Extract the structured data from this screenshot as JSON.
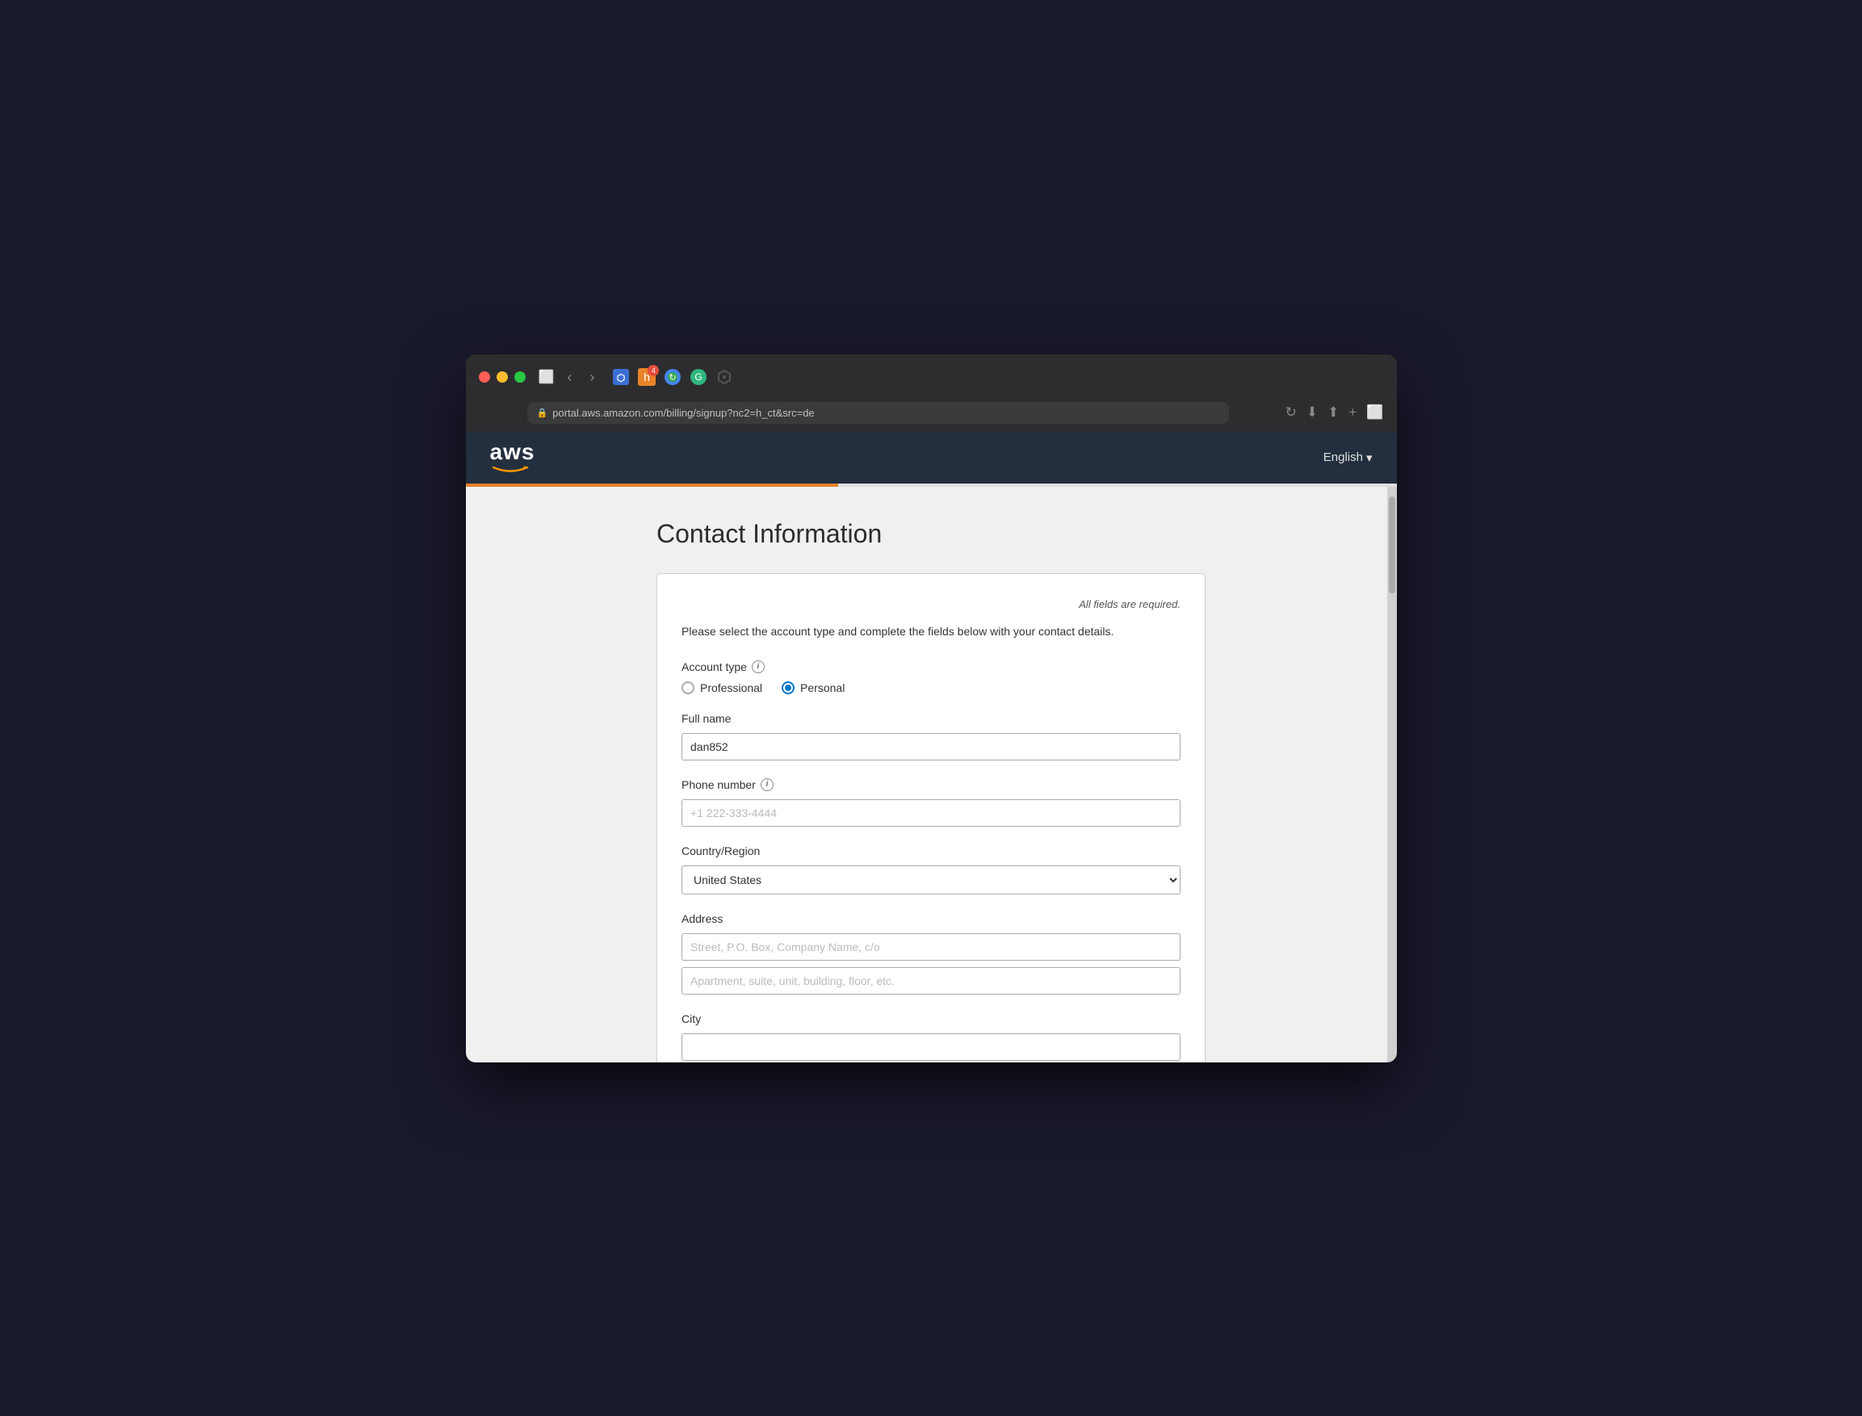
{
  "browser": {
    "url": "portal.aws.amazon.com/billing/signup?nc2=h_ct&src=de...",
    "url_display": "portal.aws.amazon.com/billing/signup?nc2=h_ct&src=de",
    "lang": "English",
    "lang_dropdown": "▾"
  },
  "header": {
    "logo_text": "aws",
    "logo_smile": "〜",
    "language_label": "English",
    "language_arrow": "▾"
  },
  "page": {
    "title": "Contact Information",
    "required_note": "All fields are required.",
    "intro": "Please select the account type and complete the fields below with your contact details."
  },
  "form": {
    "account_type_label": "Account type",
    "professional_label": "Professional",
    "personal_label": "Personal",
    "selected_account_type": "personal",
    "full_name_label": "Full name",
    "full_name_value": "dan852",
    "phone_label": "Phone number",
    "phone_placeholder": "+1 222-333-4444",
    "country_label": "Country/Region",
    "country_value": "United States",
    "address_label": "Address",
    "address_placeholder_1": "Street, P.O. Box, Company Name, c/o",
    "address_placeholder_2": "Apartment, suite, unit, building, floor, etc.",
    "city_label": "City"
  }
}
